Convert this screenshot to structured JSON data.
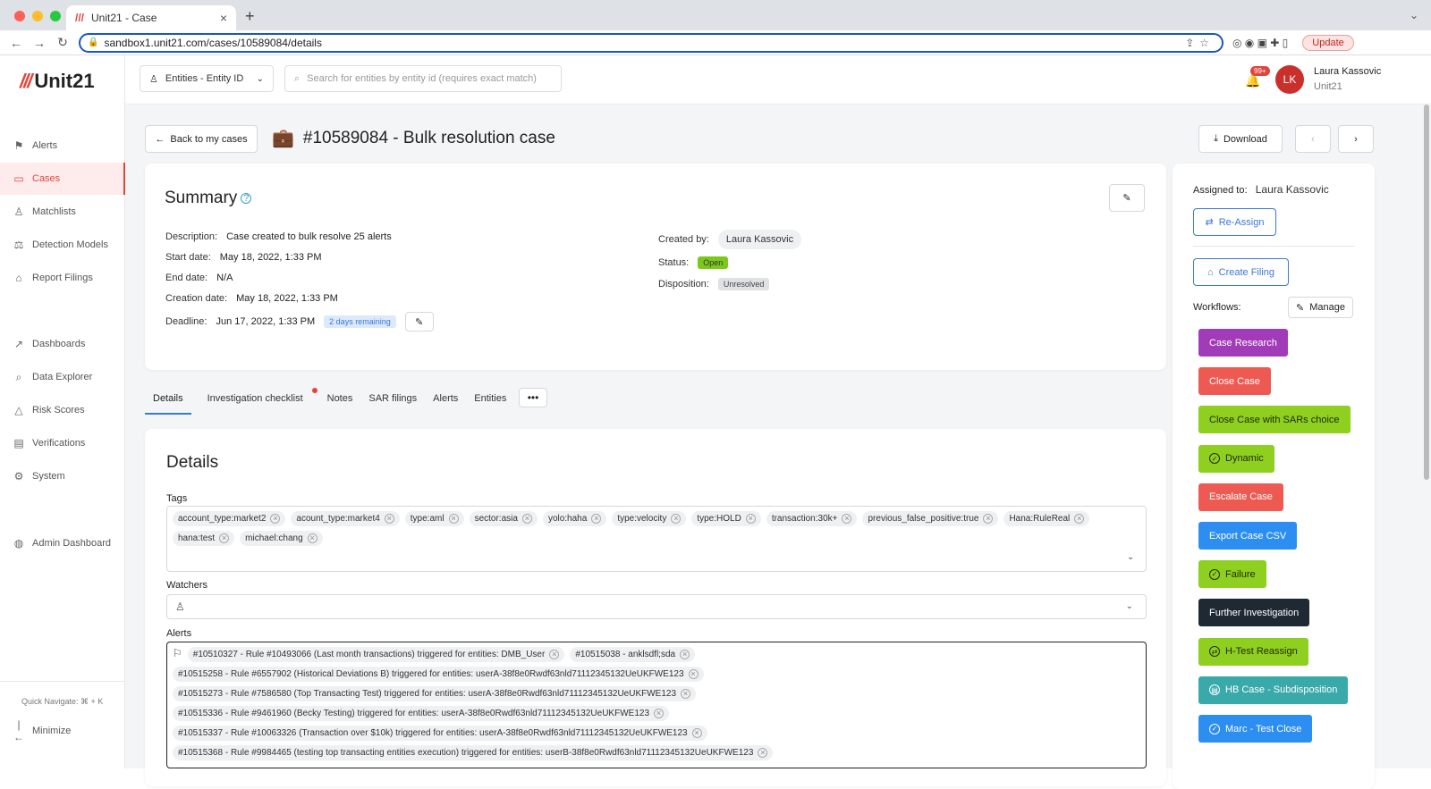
{
  "browser": {
    "tab_title": "Unit21 - Case",
    "url": "sandbox1.unit21.com/cases/10589084/details",
    "update_label": "Update"
  },
  "app": {
    "logo": "Unit21"
  },
  "sidebar": {
    "items": [
      {
        "label": "Alerts",
        "icon": "flag-icon"
      },
      {
        "label": "Cases",
        "icon": "briefcase-icon"
      },
      {
        "label": "Matchlists",
        "icon": "user-plus-icon"
      },
      {
        "label": "Detection Models",
        "icon": "scale-icon"
      },
      {
        "label": "Report Filings",
        "icon": "bank-icon"
      },
      {
        "label": "Dashboards",
        "icon": "chart-icon"
      },
      {
        "label": "Data Explorer",
        "icon": "table-search-icon"
      },
      {
        "label": "Risk Scores",
        "icon": "warning-icon"
      },
      {
        "label": "Verifications",
        "icon": "id-card-icon"
      },
      {
        "label": "System",
        "icon": "gear-icon"
      },
      {
        "label": "Admin Dashboard",
        "icon": "globe-icon"
      }
    ],
    "quick_navigate": "Quick Navigate: ⌘ + K",
    "minimize": "Minimize"
  },
  "topbar": {
    "entity_select": "Entities - Entity ID",
    "search_placeholder": "Search for entities by entity id (requires exact match)",
    "notif_count": "99+",
    "user_initials": "LK",
    "user_name": "Laura Kassovic",
    "user_org": "Unit21"
  },
  "page": {
    "back_label": "Back to my cases",
    "title": "#10589084 - Bulk resolution case",
    "download_label": "Download"
  },
  "summary": {
    "title": "Summary",
    "description_label": "Description:",
    "description": "Case created to bulk resolve 25 alerts",
    "start_label": "Start date:",
    "start": "May 18, 2022, 1:33 PM",
    "end_label": "End date:",
    "end": "N/A",
    "creation_label": "Creation date:",
    "creation": "May 18, 2022, 1:33 PM",
    "deadline_label": "Deadline:",
    "deadline": "Jun 17, 2022, 1:33 PM",
    "remaining": "2 days remaining",
    "created_by_label": "Created by:",
    "created_by": "Laura Kassovic",
    "status_label": "Status:",
    "status": "Open",
    "disposition_label": "Disposition:",
    "disposition": "Unresolved"
  },
  "tabs": [
    "Details",
    "Investigation checklist",
    "Notes",
    "SAR filings",
    "Alerts",
    "Entities"
  ],
  "details": {
    "title": "Details",
    "tags_label": "Tags",
    "watchers_label": "Watchers",
    "alerts_label": "Alerts",
    "tags": [
      "account_type:market2",
      "acount_type:market4",
      "type:aml",
      "sector:asia",
      "yolo:haha",
      "type:velocity",
      "type:HOLD",
      "transaction:30k+",
      "previous_false_positive:true",
      "Hana:RuleReal",
      "hana:test",
      "michael:chang"
    ],
    "alerts": [
      "#10510327 - Rule #10493066 (Last month transactions) triggered for entities: DMB_User",
      "#10515038 - anklsdfl;sda",
      "#10515258 - Rule #6557902 (Historical Deviations B) triggered for entities: userA-38f8e0Rwdf63nld71112345132UeUKFWE123",
      "#10515273 - Rule #7586580 (Top Transacting Test) triggered for entities: userA-38f8e0Rwdf63nld71112345132UeUKFWE123",
      "#10515336 - Rule #9461960 (Becky Testing) triggered for entities: userA-38f8e0Rwdf63nld71112345132UeUKFWE123",
      "#10515337 - Rule #10063326 (Transaction over $10k) triggered for entities: userA-38f8e0Rwdf63nld71112345132UeUKFWE123",
      "#10515368 - Rule #9984465 (testing top transacting entities execution) triggered for entities: userB-38f8e0Rwdf63nld71112345132UeUKFWE123"
    ]
  },
  "right": {
    "assigned_label": "Assigned to:",
    "assigned": "Laura Kassovic",
    "reassign": "Re-Assign",
    "create_filing": "Create Filing",
    "workflows_label": "Workflows:",
    "manage": "Manage",
    "workflows": [
      {
        "label": "Case Research",
        "bg": "#a23bb8",
        "fg": "#ffffff"
      },
      {
        "label": "Close Case",
        "bg": "#ee5a52",
        "fg": "#ffffff"
      },
      {
        "label": "Close Case with SARs choice",
        "bg": "#8fcf1f",
        "fg": "#1d2a05"
      },
      {
        "label": "Dynamic",
        "bg": "#8fcf1f",
        "fg": "#1d2a05"
      },
      {
        "label": "Escalate Case",
        "bg": "#ee5a52",
        "fg": "#ffffff"
      },
      {
        "label": "Export Case CSV",
        "bg": "#2c8ef0",
        "fg": "#ffffff"
      },
      {
        "label": "Failure",
        "bg": "#8fcf1f",
        "fg": "#1d2a05"
      },
      {
        "label": "Further Investigation",
        "bg": "#1f2933",
        "fg": "#ffffff"
      },
      {
        "label": "H-Test Reassign",
        "bg": "#8fcf1f",
        "fg": "#1d2a05"
      },
      {
        "label": "HB Case - Subdisposition",
        "bg": "#3aa9a9",
        "fg": "#ffffff"
      },
      {
        "label": "Marc - Test Close",
        "bg": "#2c8ef0",
        "fg": "#ffffff"
      }
    ]
  }
}
